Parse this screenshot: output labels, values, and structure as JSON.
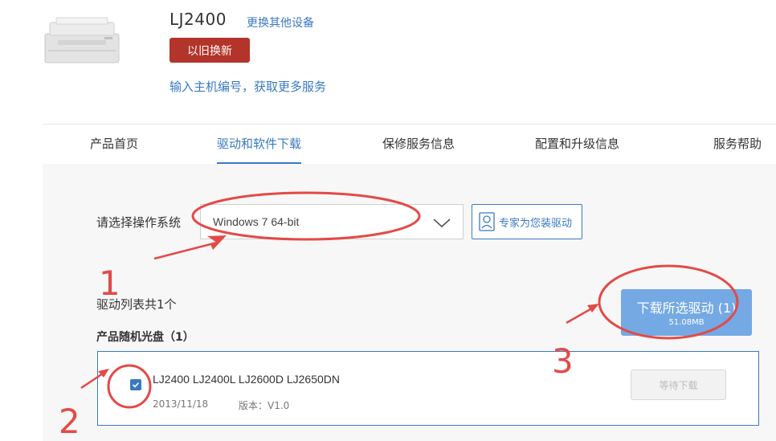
{
  "product": {
    "title": "LJ2400",
    "change_device_link": "更换其他设备",
    "tradein_button": "以旧换新",
    "serial_link": "输入主机编号，获取更多服务"
  },
  "tabs": [
    {
      "label": "产品首页",
      "active": false
    },
    {
      "label": "驱动和软件下载",
      "active": true
    },
    {
      "label": "保修服务信息",
      "active": false
    },
    {
      "label": "配置和升级信息",
      "active": false
    },
    {
      "label": "服务帮助",
      "active": false
    }
  ],
  "os": {
    "label": "请选择操作系统",
    "selected": "Windows 7 64-bit",
    "expert_button": "专家为您装驱动"
  },
  "drivers": {
    "count_text": "驱动列表共1个",
    "section_title": "产品随机光盘（1）",
    "download_button": "下载所选驱动 (1)",
    "download_size": "51.08MB",
    "items": [
      {
        "name": "LJ2400 LJ2400L LJ2600D LJ2650DN",
        "date": "2013/11/18",
        "version": "版本：V1.0",
        "checked": true,
        "status_button": "等待下载"
      }
    ]
  },
  "annotations": {
    "marker_1": "1",
    "marker_2": "2",
    "marker_3": "3"
  },
  "colors": {
    "accent": "#3a79c2",
    "tradein": "#b3342a",
    "download": "#74a9e4",
    "annotation": "#e34a47"
  }
}
